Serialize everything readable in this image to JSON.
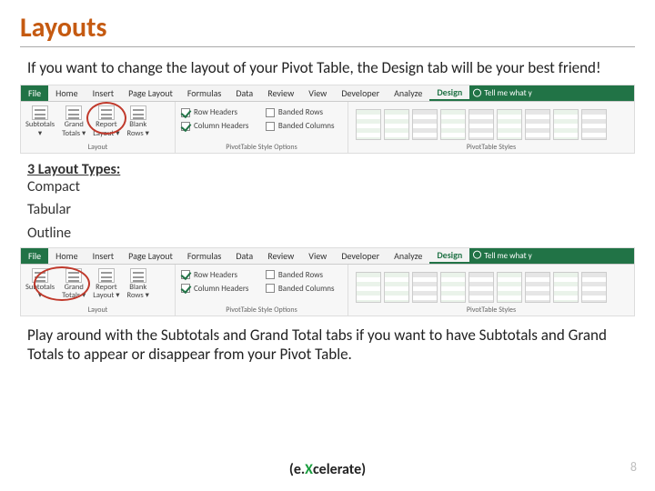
{
  "title": "Layouts",
  "intro": "If you want to change the layout of your Pivot Table, the Design tab will be your best friend!",
  "layout_section": {
    "heading": "3 Layout Types:",
    "items": [
      "Compact",
      "Tabular",
      "Outline"
    ]
  },
  "outro": "Play around with the Subtotals and Grand Total tabs if you want to have Subtotals and Grand Totals to appear or disappear from your Pivot Table.",
  "ribbon": {
    "tabs": [
      "File",
      "Home",
      "Insert",
      "Page Layout",
      "Formulas",
      "Data",
      "Review",
      "View",
      "Developer",
      "Analyze",
      "Design"
    ],
    "tellme": "Tell me what y",
    "layout_group_label": "Layout",
    "style_opts_label": "PivotTable Style Options",
    "styles_label": "PivotTable Styles",
    "buttons": {
      "subtotals": "Subtotals",
      "grand_totals_l1": "Grand",
      "grand_totals_l2": "Totals ▾",
      "report_l1": "Report",
      "report_l2": "Layout ▾",
      "blank_l1": "Blank",
      "blank_l2": "Rows ▾"
    },
    "checks": {
      "row_headers": "Row Headers",
      "col_headers": "Column Headers",
      "banded_rows": "Banded Rows",
      "banded_cols": "Banded Columns"
    }
  },
  "brand": {
    "pre": "(e.",
    "x": "X",
    "post": "celerate)"
  },
  "page_number": "8"
}
